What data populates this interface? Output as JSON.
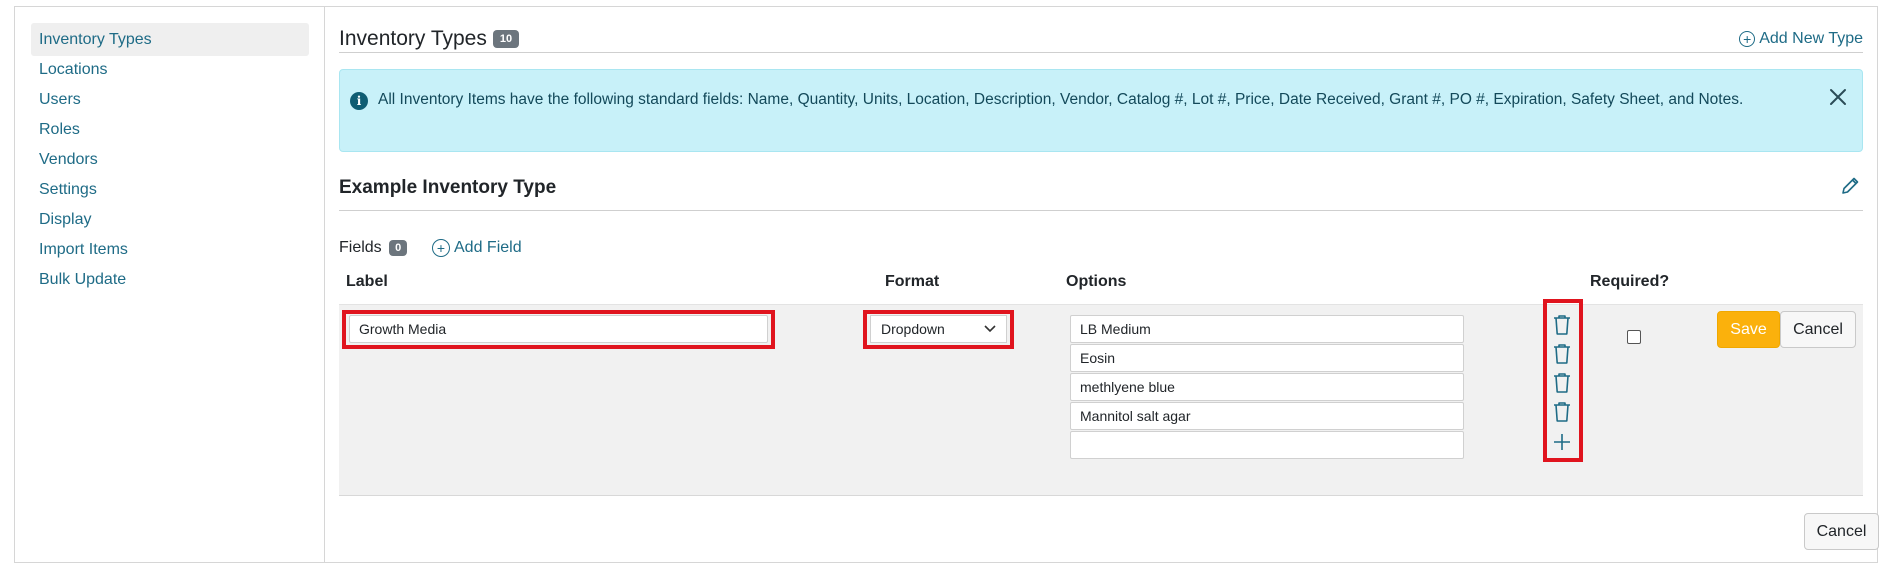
{
  "sidebar": {
    "items": [
      {
        "label": "Inventory Types",
        "active": true
      },
      {
        "label": "Locations"
      },
      {
        "label": "Users"
      },
      {
        "label": "Roles"
      },
      {
        "label": "Vendors"
      },
      {
        "label": "Settings"
      },
      {
        "label": "Display"
      },
      {
        "label": "Import Items"
      },
      {
        "label": "Bulk Update"
      }
    ]
  },
  "header": {
    "title": "Inventory Types",
    "count": "10",
    "add_new_label": "Add New Type"
  },
  "alert": {
    "text": "All Inventory Items have the following standard fields: Name, Quantity, Units, Location, Description, Vendor, Catalog #, Lot #, Price, Date Received, Grant #, PO #, Expiration, Safety Sheet, and Notes."
  },
  "type_section": {
    "title": "Example Inventory Type",
    "fields_label": "Fields",
    "fields_count": "0",
    "add_field_label": "Add Field"
  },
  "table": {
    "headers": {
      "label": "Label",
      "format": "Format",
      "options": "Options",
      "required": "Required?"
    },
    "edit_row": {
      "label_value": "Growth Media",
      "format_value": "Dropdown",
      "options": [
        "LB Medium",
        "Eosin",
        "methlyene blue",
        "Mannitol salt agar"
      ],
      "new_option_value": "",
      "required": false,
      "save_label": "Save",
      "cancel_label": "Cancel"
    }
  },
  "footer": {
    "cancel_label": "Cancel"
  },
  "colors": {
    "link": "#1e6b86",
    "alert_bg": "#c8f1f9",
    "save_button": "#fbb10c",
    "highlight": "#e0141e"
  }
}
